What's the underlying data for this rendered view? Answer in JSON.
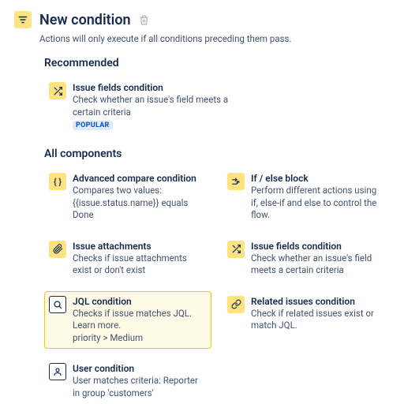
{
  "header": {
    "title": "New condition"
  },
  "subtitle": "Actions will only execute if all conditions preceding them pass.",
  "recommended": {
    "title": "Recommended",
    "card": {
      "title": "Issue fields condition",
      "desc": "Check whether an issue's field meets a certain criteria",
      "badge": "POPULAR"
    }
  },
  "all": {
    "title": "All components",
    "items": [
      {
        "icon": "braces",
        "title": "Advanced compare condition",
        "desc": "Compares two values: {{issue.status.name}} equals Done"
      },
      {
        "icon": "branch",
        "title": "If / else block",
        "desc": "Perform different actions using if, else-if and else to control the flow."
      },
      {
        "icon": "clip",
        "title": "Issue attachments",
        "desc": "Checks if issue attachments exist or don't exist"
      },
      {
        "icon": "shuffle",
        "title": "Issue fields condition",
        "desc": "Check whether an issue's field meets a certain criteria"
      },
      {
        "icon": "search",
        "title": "JQL condition",
        "desc": "Checks if issue matches JQL. Learn more.\npriority > Medium",
        "selected": true
      },
      {
        "icon": "link",
        "title": "Related issues condition",
        "desc": "Check if related issues exist or match JQL."
      },
      {
        "icon": "user",
        "title": "User condition",
        "desc": "User matches criteria: Reporter in group 'customers'"
      }
    ]
  }
}
